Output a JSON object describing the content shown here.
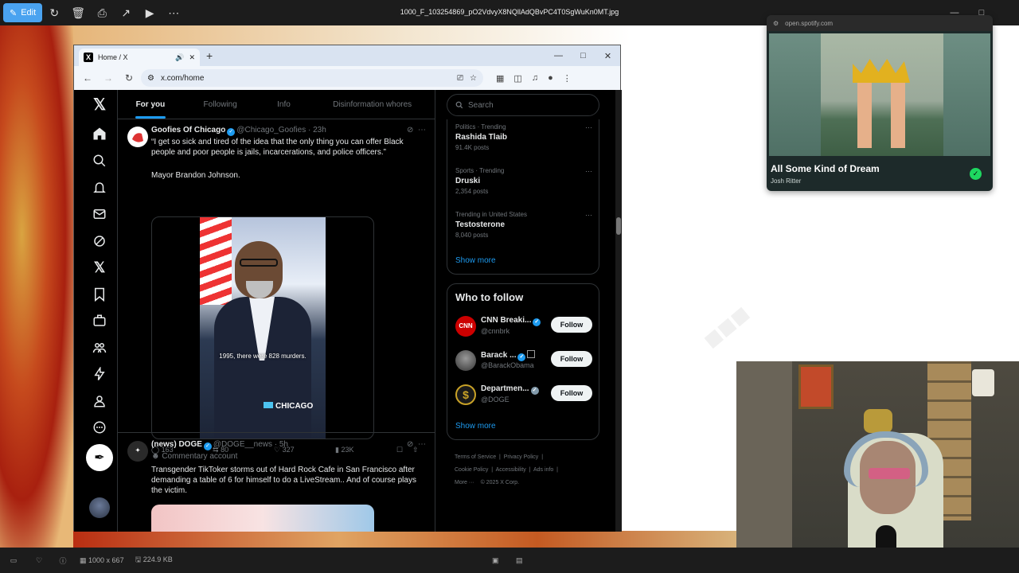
{
  "viewer": {
    "edit_label": "Edit",
    "filename": "1000_F_103254869_pO2VdvyX8NQllAdQBvPC4T0SgWuKn0MT.jpg",
    "dimensions": "1000 x 667",
    "filesize": "224.9 KB"
  },
  "browser": {
    "tab_title": "Home / X",
    "url": "x.com/home"
  },
  "x": {
    "tabs": [
      "For you",
      "Following",
      "Info",
      "Disinformation whores"
    ],
    "accent": "#1d9bf0",
    "posts": [
      {
        "name": "Goofies Of Chicago",
        "handle": "@Chicago_Goofies",
        "time": "· 23h",
        "text": "“I get so sick and tired of the idea that the only thing you can offer Black people and poor people is jails, incarcerations, and police officers.”",
        "text2": "Mayor Brandon Johnson.",
        "video_caption": "1995, there were 828 murders.",
        "video_logo": "CHICAGO",
        "replies": "163",
        "reposts": "80",
        "likes": "327",
        "views": "23K"
      },
      {
        "name": "(news) DOGE",
        "handle": "@DOGE__news",
        "time": "· 5h",
        "label": "Commentary account",
        "text": "Transgender TikToker storms out of Hard Rock Cafe in San Francisco after demanding a table of 6 for himself to do a LiveStream.. And of course plays the victim."
      }
    ],
    "search_placeholder": "Search",
    "trends": [
      {
        "meta": "Politics · Trending",
        "name": "Rashida Tlaib",
        "count": "91.4K posts"
      },
      {
        "meta": "Sports · Trending",
        "name": "Druski",
        "count": "2,354 posts"
      },
      {
        "meta": "Trending in United States",
        "name": "Testosterone",
        "count": "8,040 posts"
      }
    ],
    "show_more": "Show more",
    "who_to_follow": "Who to follow",
    "follow_label": "Follow",
    "suggestions": [
      {
        "name": "CNN Breaki...",
        "handle": "@cnnbrk"
      },
      {
        "name": "Barack ...",
        "handle": "@BarackObama"
      },
      {
        "name": "Departmen...",
        "handle": "@DOGE"
      }
    ],
    "footer": {
      "tos": "Terms of Service",
      "privacy": "Privacy Policy",
      "cookie": "Cookie Policy",
      "accessibility": "Accessibility",
      "ads": "Ads info",
      "more": "More ···",
      "copyright": "© 2025 X Corp."
    }
  },
  "spotify": {
    "url": "open.spotify.com",
    "title": "All Some Kind of Dream",
    "artist": "Josh Ritter",
    "accent": "#1ed760"
  }
}
